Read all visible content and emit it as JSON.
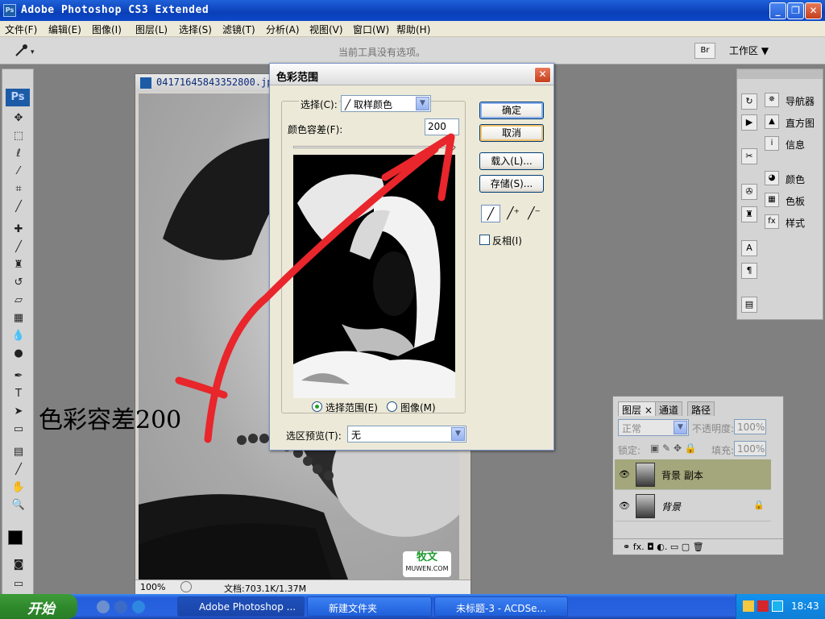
{
  "titlebar": {
    "app_title": "Adobe Photoshop CS3 Extended",
    "ps_badge": "Ps"
  },
  "window_controls": {
    "minimize": "_",
    "restore": "❐",
    "close": "✕"
  },
  "menubar": {
    "items": [
      "文件(F)",
      "编辑(E)",
      "图像(I)",
      "图层(L)",
      "选择(S)",
      "滤镜(T)",
      "分析(A)",
      "视图(V)",
      "窗口(W)",
      "帮助(H)"
    ]
  },
  "optionsbar": {
    "hint": "当前工具没有选项。",
    "workspace_label": "工作区 ▼"
  },
  "toolbox": {
    "logo": "Ps"
  },
  "document": {
    "title": "04171645843352800.jpg",
    "zoom": "100%",
    "doc_size": "文档:703.1K/1.37M",
    "watermark_top": "牧文",
    "watermark_bottom": "MUWEN.COM"
  },
  "annotation": {
    "text": "色彩容差200",
    "arrow_color": "#e8262b"
  },
  "dialog": {
    "title": "色彩范围",
    "select_label": "选择(C):",
    "select_value": "取样颜色",
    "fuzziness_label": "颜色容差(F):",
    "fuzziness_value": "200",
    "ok": "确定",
    "cancel": "取消",
    "load": "载入(L)...",
    "save": "存储(S)...",
    "invert_label": "反相(I)",
    "radio_selection": "选择范围(E)",
    "radio_image": "图像(M)",
    "preview_label": "选区预览(T):",
    "preview_value": "无",
    "fuzziness_level": 1.0
  },
  "rightdock": {
    "panels": [
      "导航器",
      "直方图",
      "信息",
      "颜色",
      "色板",
      "样式"
    ]
  },
  "layers": {
    "tabs": [
      "图层 ×",
      "通道",
      "路径"
    ],
    "blend_mode": "正常",
    "opacity_label": "不透明度:",
    "opacity_value": "100%",
    "lock_label": "锁定:",
    "fill_label": "填充:",
    "fill_value": "100%",
    "rows": [
      "背景 副本",
      "背景"
    ],
    "footer_icons": "⚭  fx.  ◘  ◐.  ▭  ▢  🗑"
  },
  "taskbar": {
    "start": "开始",
    "items": [
      "Adobe Photoshop ...",
      "新建文件夹",
      "未标题-3 - ACDSe..."
    ],
    "clock": "18:43"
  },
  "colors": {
    "accent": "#0a3fb8",
    "annotation_red": "#e8262b"
  }
}
